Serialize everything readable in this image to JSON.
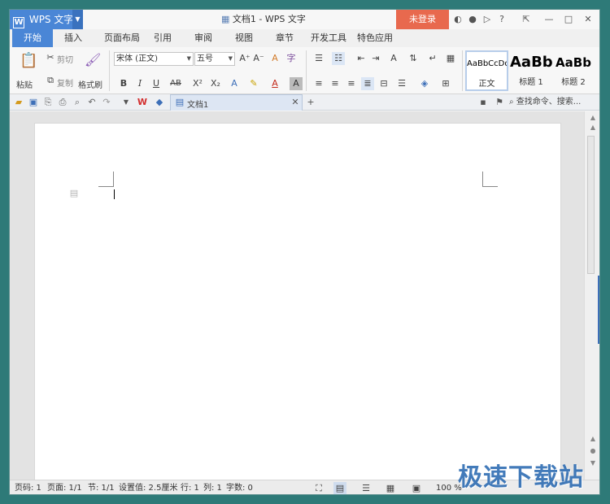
{
  "window": {
    "app_name": "WPS 文字",
    "app_logo": "W",
    "doc_title": "文档1 - WPS 文字",
    "login_label": "未登录",
    "accent_color": "#4a86d6",
    "login_color": "#e8694e"
  },
  "tabs": [
    "开始",
    "插入",
    "页面布局",
    "引用",
    "审阅",
    "视图",
    "章节",
    "开发工具",
    "特色应用"
  ],
  "ribbon": {
    "paste": "粘贴",
    "cut": "剪切",
    "copy": "复制",
    "format_painter": "格式刷",
    "font_name": "宋体 (正文)",
    "font_size": "五号",
    "bold": "B",
    "italic": "I",
    "underline": "U",
    "strike": "AB",
    "superscript": "X²",
    "subscript": "X₂",
    "styles": [
      {
        "preview": "AaBbCcDd",
        "name": "正文"
      },
      {
        "preview": "AaBb",
        "name": "标题 1"
      },
      {
        "preview": "AaBb",
        "name": "标题 2"
      }
    ]
  },
  "quickbar": {
    "doc_tab": "文档1",
    "search_placeholder": "查找命令、搜索..."
  },
  "status": {
    "page_num": "页码: 1",
    "pages": "页面: 1/1",
    "section": "节: 1/1",
    "setting": "设置值: 2.5厘米",
    "row": "行: 1",
    "col": "列: 1",
    "words": "字数: 0",
    "zoom": "100 %"
  },
  "watermark": "极速下载站"
}
